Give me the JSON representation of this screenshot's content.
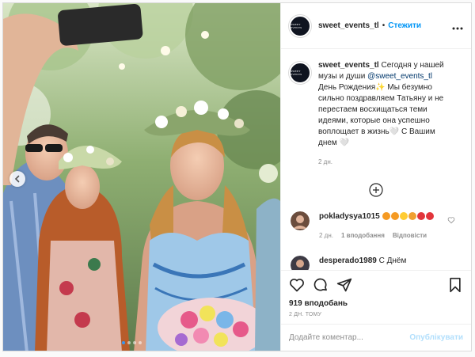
{
  "post": {
    "username": "sweet_events_tl",
    "separator": "•",
    "follow_label": "Стежити",
    "more_icon": "more-horizontal-icon",
    "avatar_text": "SWEET EVENTS",
    "caption": {
      "intro": "Сегодня у нашей музы и души ",
      "mention": "@sweet_events_tl",
      "rest": " День Рождения✨ Мы безумно сильно поздравляем Татьяну и не перестаем восхищаться теми идеями, которые она успешно воплощает в жизнь🤍 С Вашим днем 🤍",
      "time": "2 дн."
    },
    "load_more_icon": "plus-circle-icon",
    "comments": [
      {
        "username": "pokladysya1015",
        "emojis": [
          "#f59a23",
          "#f59a23",
          "#ffcc33",
          "#f0a030",
          "#e2353b",
          "#e2353b"
        ],
        "time": "2 дн.",
        "likes": "1 вподобання",
        "reply": "Відповісти"
      },
      {
        "username": "desperado1989",
        "text": "С Днём"
      }
    ],
    "likes_count": "919 вподобань",
    "posted_time": "2 ДН. ТОМУ",
    "comment_placeholder": "Додайте коментар...",
    "publish_label": "Опублікувати",
    "colors": {
      "accent": "#0095f6",
      "publish_disabled": "#b2dffc",
      "muted": "#8e8e8e",
      "text": "#262626"
    }
  }
}
